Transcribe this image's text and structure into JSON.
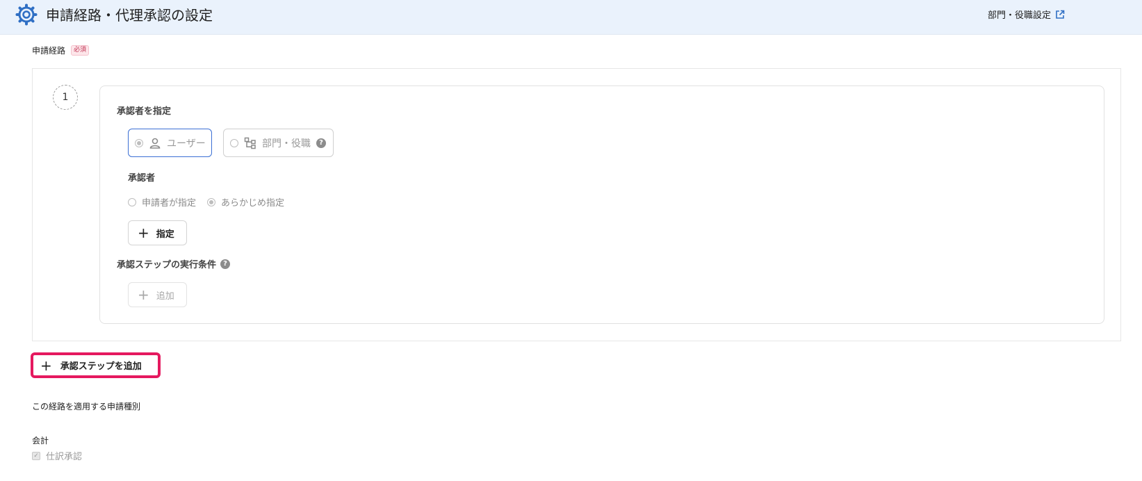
{
  "header": {
    "title": "申請経路・代理承認の設定",
    "dept_link_label": "部門・役職設定",
    "icons": [
      "gear-icon",
      "external-link-icon"
    ]
  },
  "route": {
    "label": "申請経路",
    "required_badge": "必須"
  },
  "step": {
    "number": "1",
    "approver_spec_label": "承認者を指定",
    "type_options": [
      {
        "label": "ユーザー",
        "icon": "user-icon",
        "selected": true
      },
      {
        "label": "部門・役職",
        "icon": "org-chart-icon",
        "selected": false
      }
    ],
    "approver_label": "承認者",
    "approver_options": [
      {
        "label": "申請者が指定",
        "checked": false
      },
      {
        "label": "あらかじめ指定",
        "checked": true
      }
    ],
    "designate_button": "指定",
    "condition_label": "承認ステップの実行条件",
    "add_condition_button": "追加"
  },
  "add_step_button": "承認ステップを追加",
  "apply_section": {
    "label": "この経路を適用する申請種別",
    "group_label": "会計",
    "checkbox_label": "仕訳承認",
    "checkbox_checked": true
  },
  "colors": {
    "header_bg": "#eaf2fc",
    "accent_blue": "#3b6fd4",
    "highlight_pink": "#e5195f",
    "required_red": "#c03353"
  }
}
